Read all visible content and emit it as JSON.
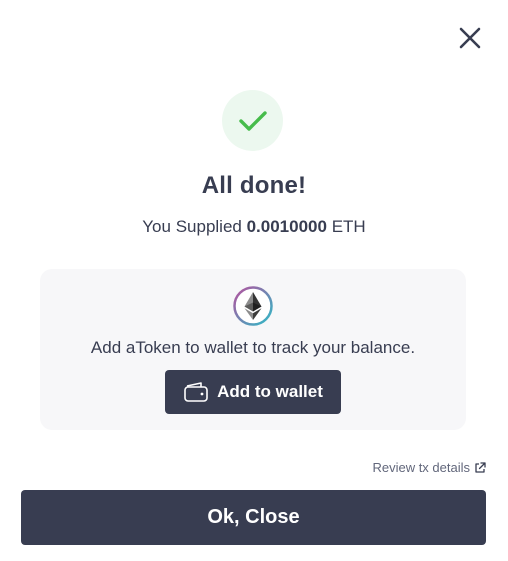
{
  "modal": {
    "close_icon": "close-icon",
    "status_icon": "check-icon",
    "status_color": "#46bc4b",
    "title": "All done!",
    "summary": {
      "prefix": "You Supplied",
      "amount": "0.0010000",
      "asset": "ETH"
    },
    "panel": {
      "token_icon": "eth-icon",
      "message": "Add aToken to wallet to track your balance.",
      "add_button": {
        "icon": "wallet-icon",
        "label": "Add to wallet"
      }
    },
    "review_link": {
      "label": "Review tx details",
      "icon": "external-link-icon"
    },
    "ok_button": {
      "label": "Ok, Close"
    }
  },
  "colors": {
    "primary_dark": "#383d51",
    "panel_bg": "#f7f7f9",
    "success_bg": "#ecf8ef",
    "success": "#46bc4b"
  }
}
